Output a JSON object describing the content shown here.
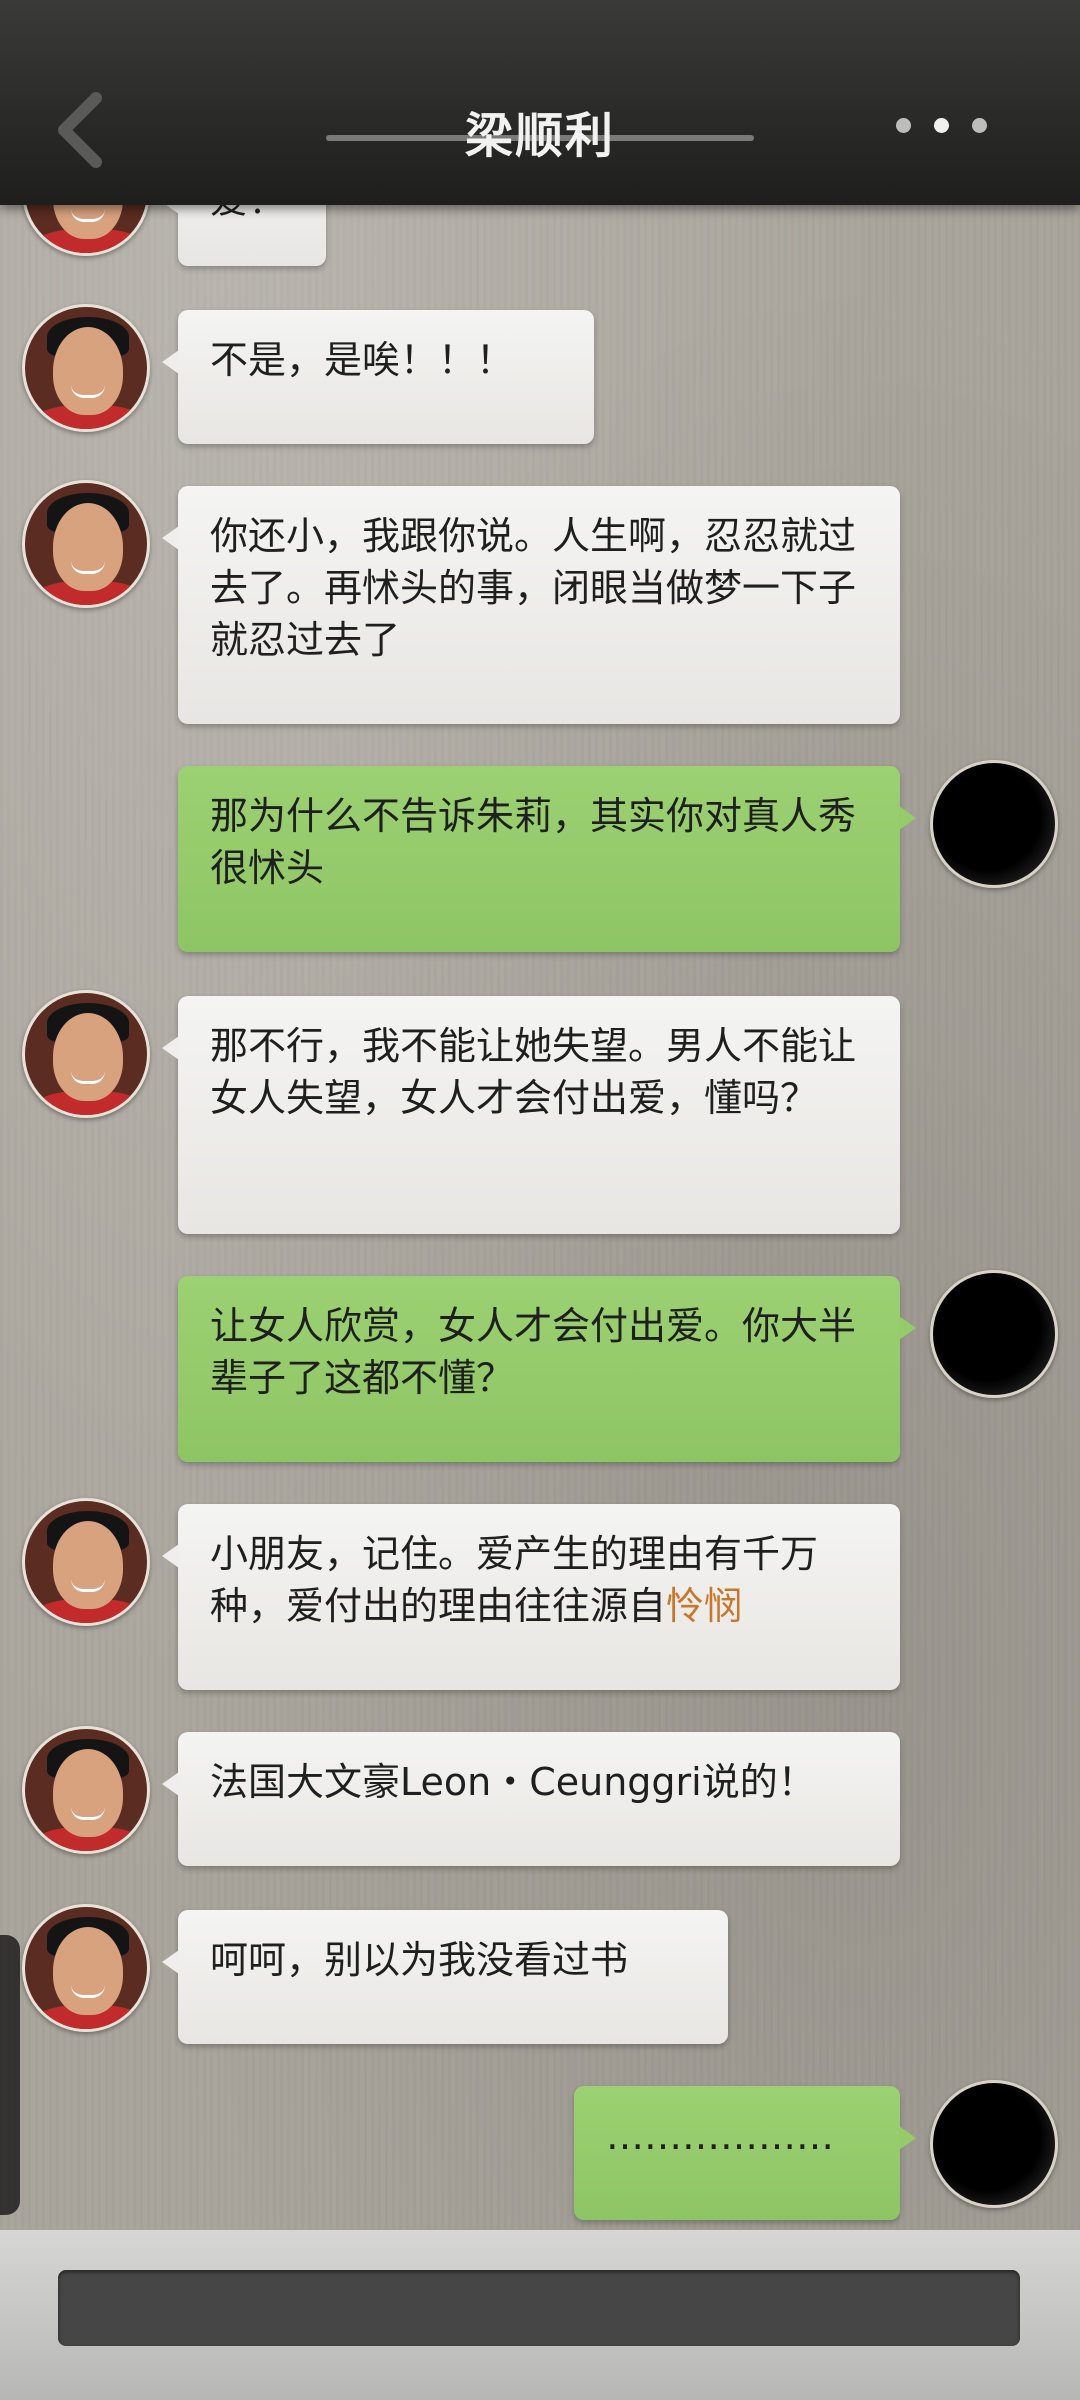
{
  "header": {
    "title": "梁顺利",
    "back_icon": "chevron-left-icon",
    "menu_icon": "more-dots-icon"
  },
  "messages": [
    {
      "side": "in",
      "text": "爱！"
    },
    {
      "side": "in",
      "text": "不是，是唉！！！"
    },
    {
      "side": "in",
      "text": "你还小，我跟你说。人生啊，忍忍就过去了。再怵头的事，闭眼当做梦一下子就忍过去了"
    },
    {
      "side": "out",
      "text": "那为什么不告诉朱莉，其实你对真人秀很怵头"
    },
    {
      "side": "in",
      "text": "那不行，我不能让她失望。男人不能让女人失望，女人才会付出爱，懂吗？"
    },
    {
      "side": "out",
      "text": "让女人欣赏，女人才会付出爱。你大半辈子了这都不懂？"
    },
    {
      "side": "in",
      "text_before": "小朋友，记住。爱产生的理由有千万种，爱付出的理由往往源自",
      "highlight": "怜悯"
    },
    {
      "side": "in",
      "text": "法国大文豪Leon・Ceunggri说的！"
    },
    {
      "side": "in",
      "text": "呵呵，别以为我没看过书"
    },
    {
      "side": "out",
      "text": "………………"
    }
  ],
  "composer": {
    "input_value": ""
  },
  "colors": {
    "header_bg": "#262624",
    "incoming_bubble": "#efeeec",
    "outgoing_bubble": "#95cb69",
    "highlight": "#c9762d"
  }
}
